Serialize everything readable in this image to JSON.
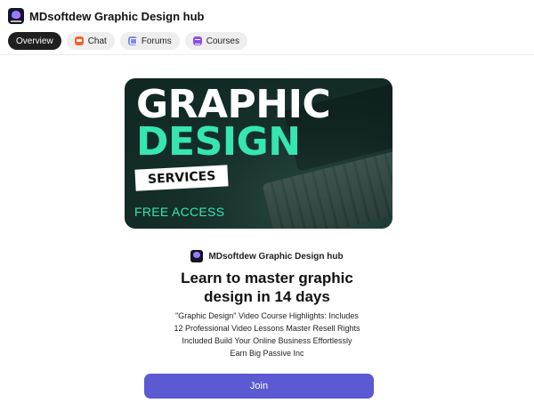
{
  "app": {
    "title": "MDsoftdew Graphic Design hub"
  },
  "tabs": [
    {
      "label": "Overview",
      "icon": "",
      "active": true
    },
    {
      "label": "Chat",
      "icon": "chat-icon"
    },
    {
      "label": "Forums",
      "icon": "forums-icon"
    },
    {
      "label": "Courses",
      "icon": "courses-icon"
    }
  ],
  "banner": {
    "line1": "GRAPHIC",
    "line2": "DESIGN",
    "tag": "SERVICES",
    "free": "FREE ACCESS",
    "accent": "#35e6b1"
  },
  "hub": {
    "name": "MDsoftdew Graphic Design hub"
  },
  "headline": {
    "line1": "Learn to master graphic",
    "line2": "design in 14 days"
  },
  "description": [
    "\"Graphic Design\" Video Course Highlights: Includes",
    "12 Professional Video Lessons Master Resell Rights",
    "Included Build Your Online Business Effortlessly",
    "Earn Big Passive Inc"
  ],
  "join": {
    "label": "Join",
    "color": "#5c5ad3"
  }
}
